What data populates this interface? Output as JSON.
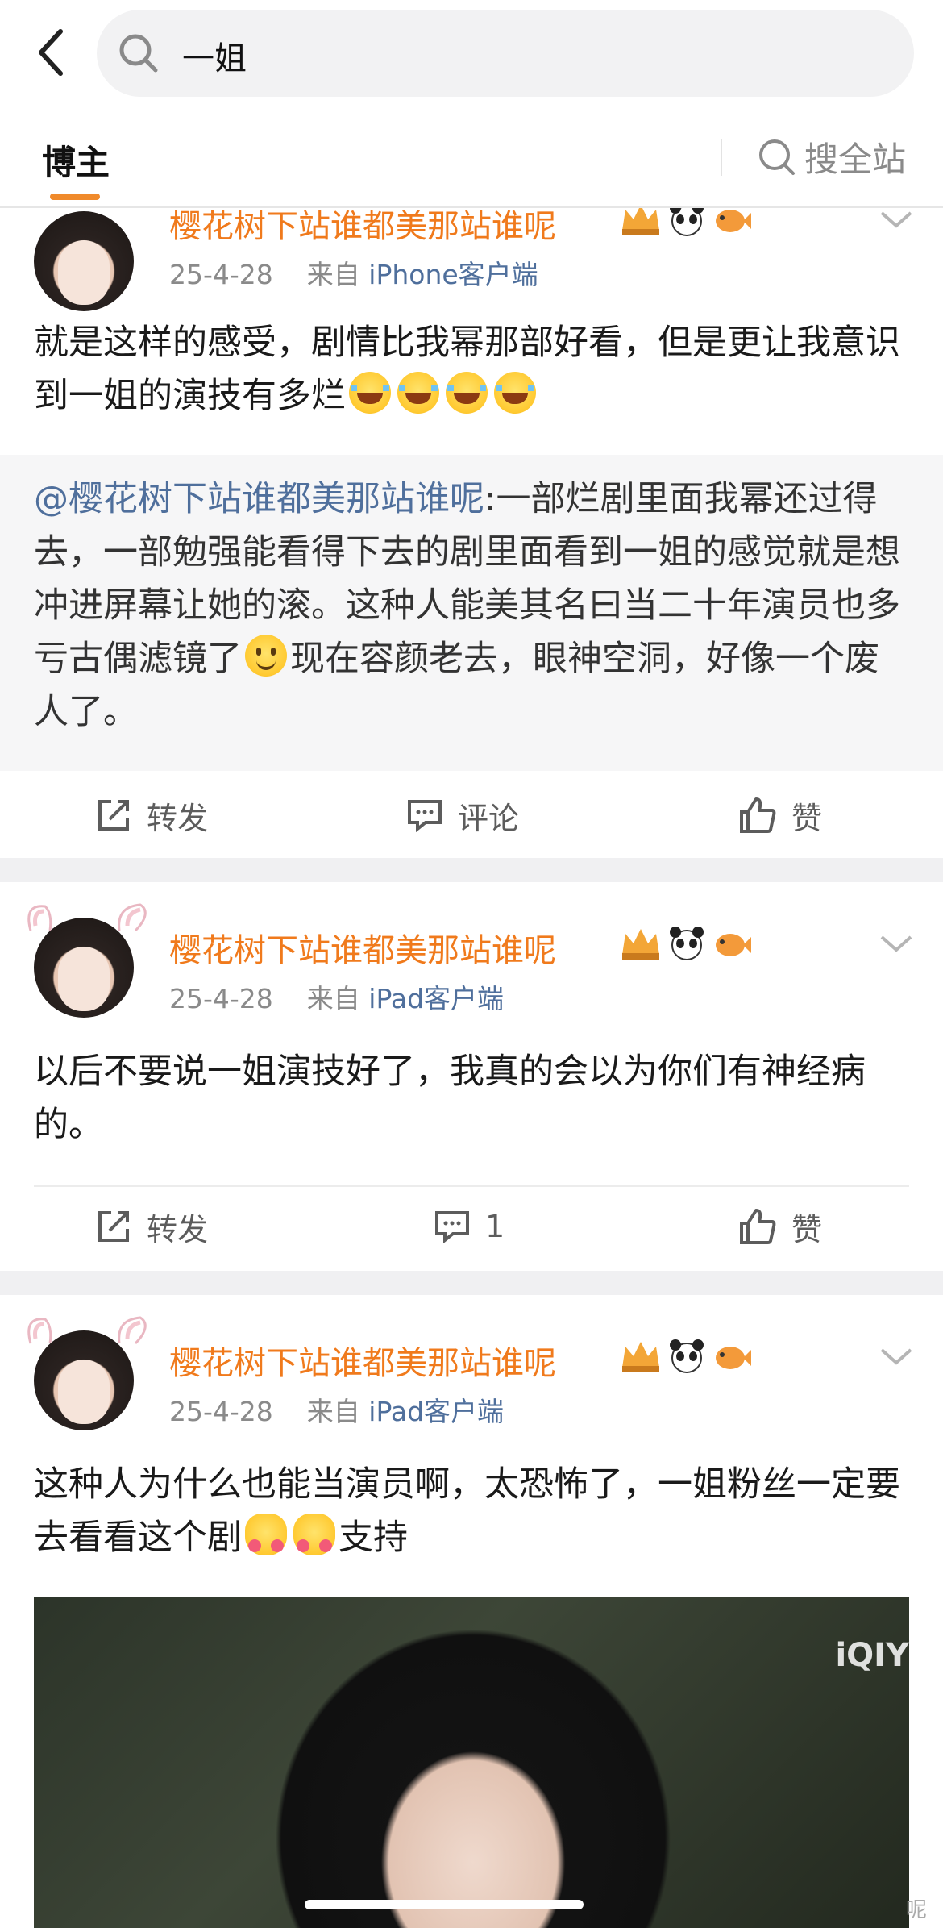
{
  "search": {
    "query": "一姐"
  },
  "tabs": {
    "blogger": "博主",
    "search_all": "搜全站"
  },
  "posts": [
    {
      "username": "樱花树下站谁都美那站谁呢",
      "date": "25-4-28",
      "source_prefix": "来自",
      "source": "iPhone客户端",
      "text": "就是这样的感受，剧情比我幂那部好看，但是更让我意识到一姐的演技有多烂",
      "repost": {
        "mention": "@樱花树下站谁都美那站谁呢",
        "text_a": ":一部烂剧里面我幂还过得去，一部勉强能看得下去的剧里面看到一姐的感觉就是想冲进屏幕让她的滚。这种人能美其名曰当二十年演员也多亏古偶滤镜了",
        "text_b": "现在容颜老去，眼神空洞，好像一个废人了。"
      },
      "actions": {
        "repost": "转发",
        "comment": "评论",
        "like": "赞"
      }
    },
    {
      "username": "樱花树下站谁都美那站谁呢",
      "date": "25-4-28",
      "source_prefix": "来自",
      "source": "iPad客户端",
      "text": "以后不要说一姐演技好了，我真的会以为你们有神经病的。",
      "actions": {
        "repost": "转发",
        "comment": "1",
        "like": "赞"
      }
    },
    {
      "username": "樱花树下站谁都美那站谁呢",
      "date": "25-4-28",
      "source_prefix": "来自",
      "source": "iPad客户端",
      "text_a": "这种人为什么也能当演员啊，太恐怖了，一姐粉丝一定要去看看这个剧",
      "text_b": "支持",
      "video_watermark": "iQIY"
    }
  ],
  "corner_text": "呢",
  "colors": {
    "username": "#f07a1c",
    "link": "#4f6f9c",
    "accent": "#f08a2b"
  }
}
